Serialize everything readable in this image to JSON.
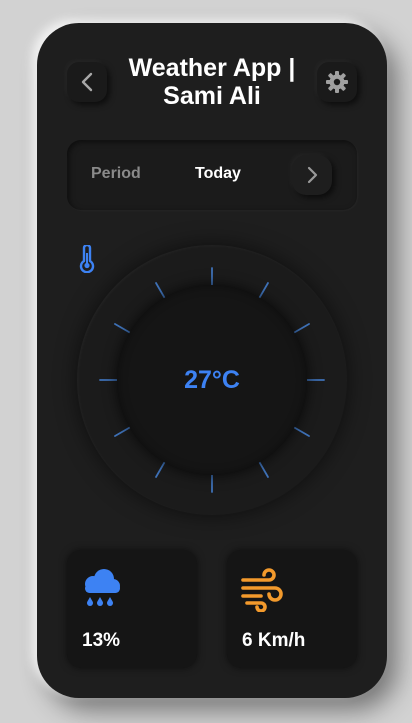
{
  "header": {
    "title_line1": "Weather App |",
    "title_line2": "Sami Ali",
    "back_icon": "chevron-left-icon",
    "settings_icon": "gear-icon"
  },
  "period": {
    "label": "Period",
    "value": "Today",
    "next_icon": "chevron-right-icon"
  },
  "temperature": {
    "value": "27°C",
    "icon": "thermometer-icon"
  },
  "stats": {
    "precipitation": {
      "value": "13%",
      "icon": "cloud-rain-icon"
    },
    "wind": {
      "value": "6 Km/h",
      "icon": "wind-icon"
    }
  },
  "colors": {
    "background": "#d2d2d2",
    "card": "#1e1e1e",
    "accent_blue": "#3d82f3",
    "accent_orange": "#f39a2c",
    "text": "#ffffff",
    "muted": "#8a8a8a"
  }
}
